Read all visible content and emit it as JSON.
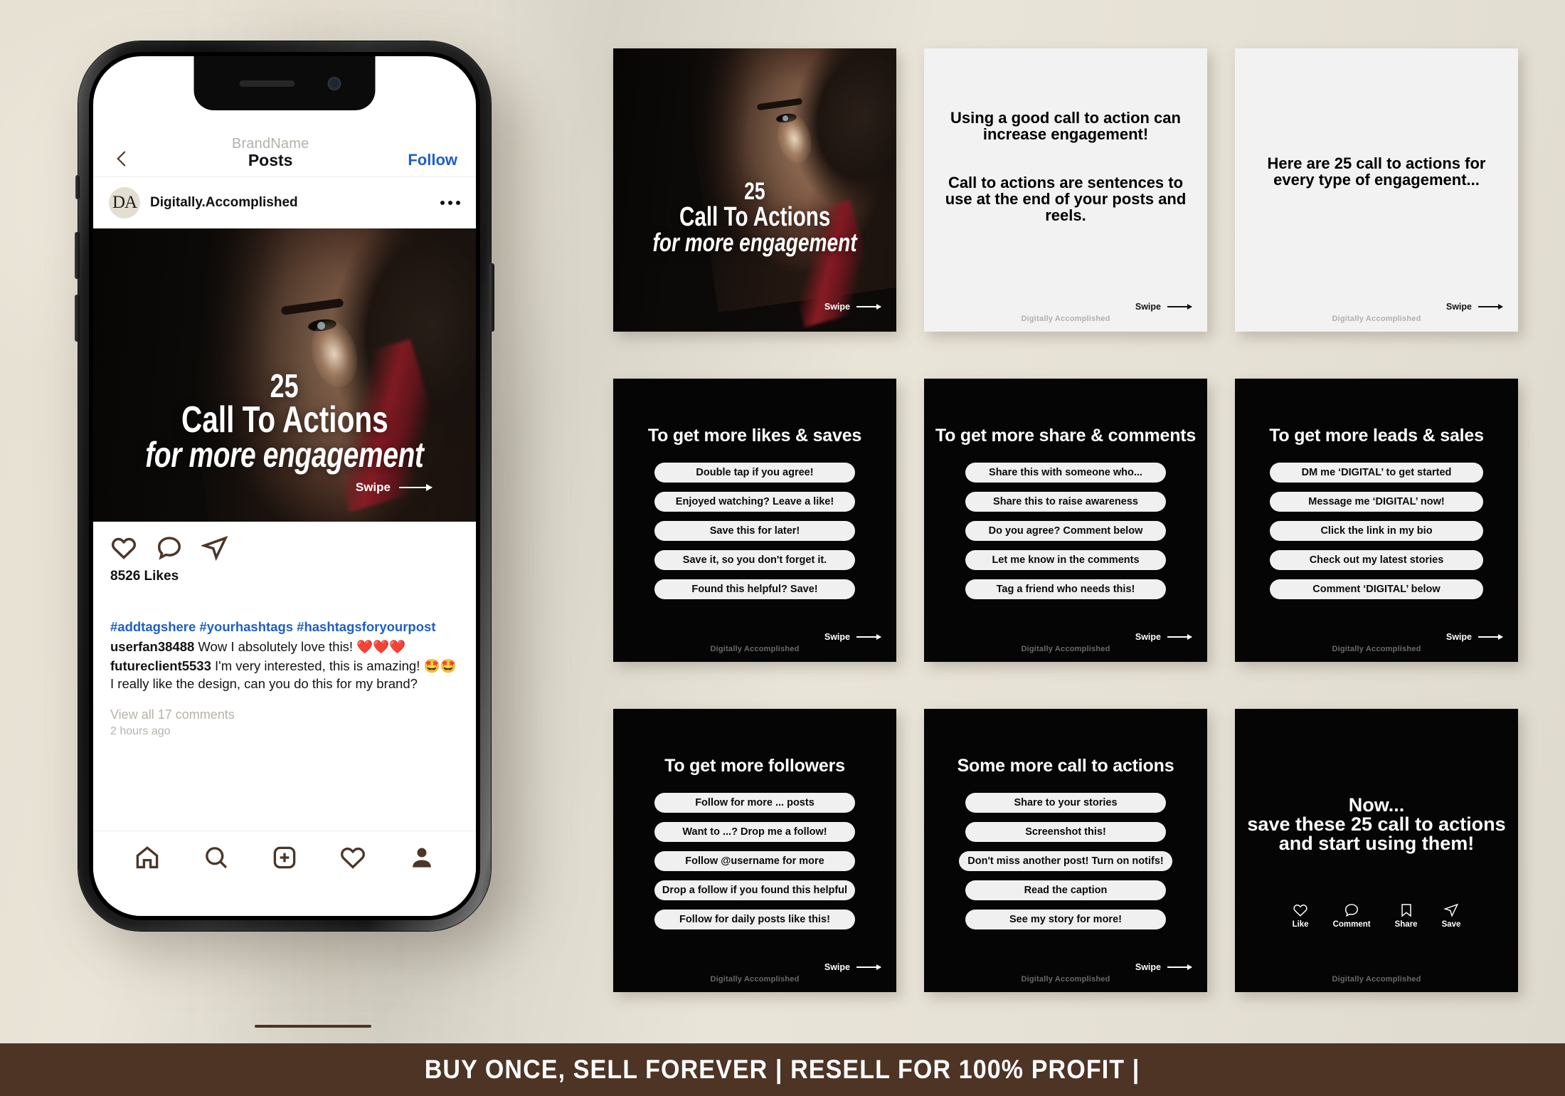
{
  "banner": {
    "text": "BUY ONCE, SELL FOREVER | RESELL FOR 100% PROFIT |",
    "bg_color": "#4d3425"
  },
  "brand": {
    "watermark": "Digitally Accomplished",
    "handle": "Digitally.Accomplished",
    "avatar_initials": "DA"
  },
  "phone": {
    "header": {
      "brand_name": "BrandName",
      "screen_title": "Posts",
      "follow_label": "Follow",
      "back_icon": "back-chevron-icon",
      "more_icon": "more-options-icon"
    },
    "post": {
      "cover_line1": "25",
      "cover_line2": "Call To Actions",
      "cover_line3": "for more engagement",
      "swipe_label": "Swipe",
      "likes": "8526 Likes",
      "hashtags": "#addtagshere #yourhashtags #hashtagsforyourpost",
      "comments": [
        {
          "user": "userfan38488",
          "text": "Wow I absolutely love this! ❤️❤️❤️"
        },
        {
          "user": "futureclient5533",
          "text": "I'm very interested, this is amazing! 🤩🤩 I really like the design, can you do this for my brand?"
        }
      ],
      "view_all": "View all 17 comments",
      "timestamp": "2 hours ago",
      "action_icons": [
        "heart-icon",
        "comment-icon",
        "share-icon"
      ]
    },
    "tabbar": [
      "home-icon",
      "search-icon",
      "add-post-icon",
      "activity-heart-icon",
      "profile-icon"
    ]
  },
  "cards": [
    {
      "id": "cover",
      "style": "photo",
      "line1": "25",
      "line2": "Call To Actions",
      "line3": "for more engagement",
      "swipe_label": "Swipe",
      "watermark": ""
    },
    {
      "id": "intro",
      "style": "light",
      "paragraphs": [
        "Using a good call to action can increase engagement!",
        "Call to actions are sentences to use at the end of your posts and reels."
      ],
      "swipe_label": "Swipe",
      "watermark": "Digitally Accomplished"
    },
    {
      "id": "here-are-25",
      "style": "light",
      "paragraphs": [
        "Here are 25 call to actions for every type of engagement..."
      ],
      "swipe_label": "Swipe",
      "watermark": "Digitally Accomplished"
    },
    {
      "id": "likes-saves",
      "style": "dark-list",
      "title": "To get more likes & saves",
      "items": [
        "Double tap if you agree!",
        "Enjoyed watching? Leave a like!",
        "Save this for later!",
        "Save it, so you don't forget it.",
        "Found this helpful? Save!"
      ],
      "swipe_label": "Swipe",
      "watermark": "Digitally Accomplished"
    },
    {
      "id": "share-comments",
      "style": "dark-list",
      "title": "To get more share & comments",
      "items": [
        "Share this with someone who...",
        "Share this to raise awareness",
        "Do you agree? Comment below",
        "Let me know in the comments",
        "Tag a friend who needs this!"
      ],
      "swipe_label": "Swipe",
      "watermark": "Digitally Accomplished"
    },
    {
      "id": "leads-sales",
      "style": "dark-list",
      "title": "To get more leads & sales",
      "items": [
        "DM me ‘DIGITAL’ to get started",
        "Message me ‘DIGITAL’ now!",
        "Click the link in my bio",
        "Check out my latest stories",
        "Comment ‘DIGITAL’ below"
      ],
      "swipe_label": "Swipe",
      "watermark": "Digitally Accomplished"
    },
    {
      "id": "followers",
      "style": "dark-list",
      "title": "To get more followers",
      "items": [
        "Follow for more ... posts",
        "Want to ...? Drop me a follow!",
        "Follow @username for more",
        "Drop a follow if you found this helpful",
        "Follow for daily posts like this!"
      ],
      "swipe_label": "Swipe",
      "watermark": "Digitally Accomplished"
    },
    {
      "id": "some-more",
      "style": "dark-list",
      "title": "Some more call to actions",
      "items": [
        "Share to your stories",
        "Screenshot this!",
        "Don't miss another post! Turn on notifs!",
        "Read the caption",
        "See my story for more!"
      ],
      "swipe_label": "Swipe",
      "watermark": "Digitally Accomplished"
    },
    {
      "id": "final",
      "style": "dark-final",
      "line1": "Now...",
      "line2": "save these 25 call to actions",
      "line3": "and start using them!",
      "icons": [
        {
          "icon": "heart-icon",
          "label": "Like"
        },
        {
          "icon": "comment-icon",
          "label": "Comment"
        },
        {
          "icon": "bookmark-icon",
          "label": "Share"
        },
        {
          "icon": "send-icon",
          "label": "Save"
        }
      ],
      "watermark": "Digitally Accomplished"
    }
  ]
}
